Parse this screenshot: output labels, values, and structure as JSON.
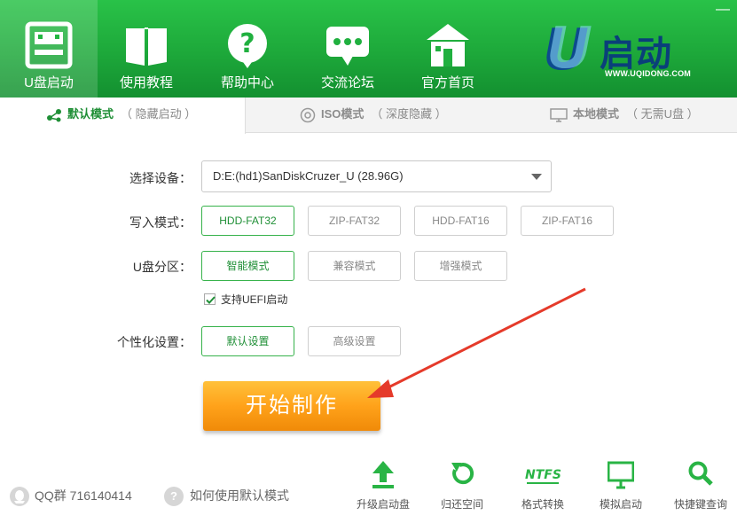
{
  "nav": {
    "items": [
      {
        "label": "U盘启动",
        "icon": "usb-drive-icon"
      },
      {
        "label": "使用教程",
        "icon": "book-icon"
      },
      {
        "label": "帮助中心",
        "icon": "help-icon"
      },
      {
        "label": "交流论坛",
        "icon": "chat-icon"
      },
      {
        "label": "官方首页",
        "icon": "home-icon"
      }
    ],
    "window_close": "—"
  },
  "logo": {
    "letter": "U",
    "text": "启动",
    "url": "WWW.UQIDONG.COM"
  },
  "tabs": [
    {
      "main": "默认模式",
      "sub": "（ 隐藏启动 ）",
      "icon": "share-icon"
    },
    {
      "main": "ISO模式",
      "sub": "（ 深度隐藏 ）",
      "icon": "disc-icon"
    },
    {
      "main": "本地模式",
      "sub": "（ 无需U盘 ）",
      "icon": "monitor-icon"
    }
  ],
  "form": {
    "device_label": "选择设备：",
    "device_value": "D:E:(hd1)SanDiskCruzer_U (28.96G)",
    "write_label": "写入模式：",
    "write_options": [
      "HDD-FAT32",
      "ZIP-FAT32",
      "HDD-FAT16",
      "ZIP-FAT16"
    ],
    "partition_label": "U盘分区：",
    "partition_options": [
      "智能模式",
      "兼容模式",
      "增强模式"
    ],
    "uefi_label": "支持UEFI启动",
    "uefi_checked": true,
    "personal_label": "个性化设置：",
    "personal_options": [
      "默认设置",
      "高级设置"
    ],
    "start_button": "开始制作"
  },
  "bottom": {
    "qq": "QQ群 716140414",
    "help": "如何使用默认模式",
    "tools": [
      {
        "label": "升级启动盘",
        "icon": "upgrade-icon"
      },
      {
        "label": "归还空间",
        "icon": "restore-icon"
      },
      {
        "label": "格式转换",
        "icon": "ntfs-icon"
      },
      {
        "label": "模拟启动",
        "icon": "simulate-monitor-icon"
      },
      {
        "label": "快捷键查询",
        "icon": "search-icon"
      }
    ],
    "ntfs_text": "NTFS"
  },
  "colors": {
    "accent": "#1da83a",
    "selected": "#36b24a",
    "start_button": "#ffa21a",
    "arrow": "#e53a2a"
  }
}
